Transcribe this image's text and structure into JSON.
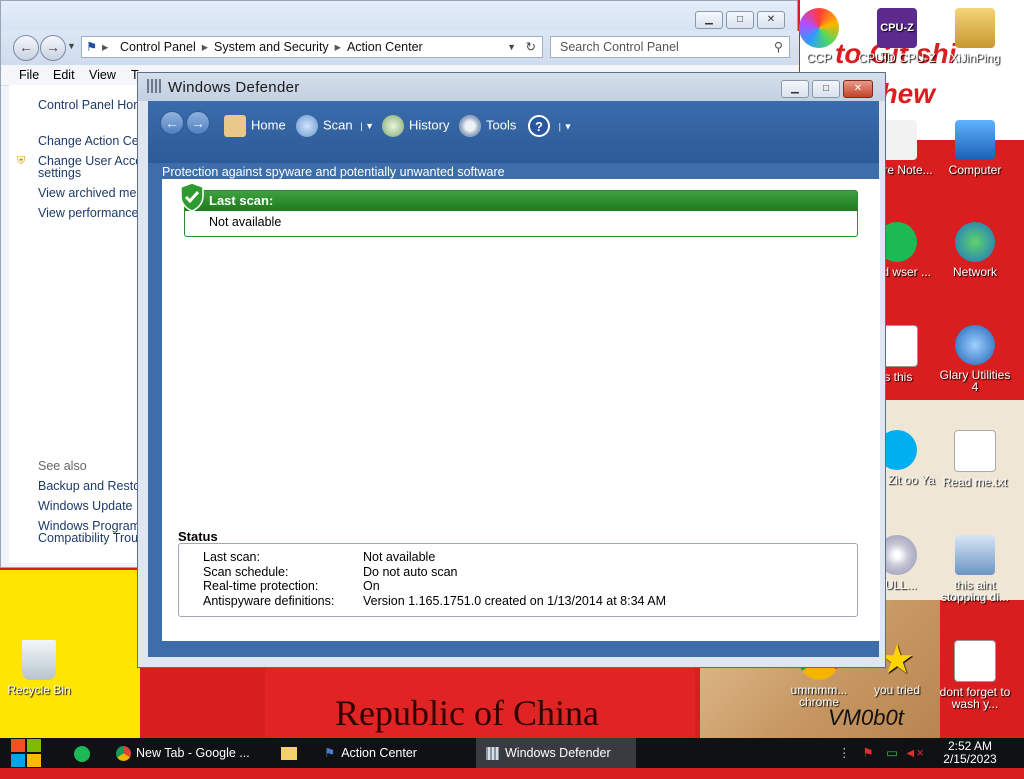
{
  "desktop": {
    "wallpaper_texts": [
      "to Git shi",
      "chew",
      "Republic of China",
      "VM0b0t"
    ],
    "icons": [
      {
        "label": "CCP",
        "icon": "colorful-logo-icon"
      },
      {
        "label": "CPUID CPU-Z",
        "icon": "cpuz-icon"
      },
      {
        "label": "XiJinPing",
        "icon": "user-file-icon"
      },
      {
        "label": "eware Note...",
        "icon": "notepad-icon"
      },
      {
        "label": "Computer",
        "icon": "computer-icon"
      },
      {
        "label": "ased wser ...",
        "icon": "spotify-icon"
      },
      {
        "label": "Network",
        "icon": "network-icon"
      },
      {
        "label": "is this",
        "icon": "document-icon"
      },
      {
        "label": "Glary Utilities 4",
        "icon": "glary-icon"
      },
      {
        "label": "what Zit oo Ya",
        "icon": "skype-icon"
      },
      {
        "label": "Read me.txt",
        "icon": "text-file-icon"
      },
      {
        "label": "BULL...",
        "icon": "disc-icon"
      },
      {
        "label": "this aint stopping di...",
        "icon": "setup-icon"
      },
      {
        "label": "ummmm... chrome",
        "icon": "chrome-icon"
      },
      {
        "label": "you tried",
        "icon": "star-icon"
      },
      {
        "label": "dont forget to wash y...",
        "icon": "document-icon"
      },
      {
        "label": "Recycle Bin",
        "icon": "recycle-bin-icon"
      }
    ]
  },
  "action_center": {
    "breadcrumb": [
      "Control Panel",
      "System and Security",
      "Action Center"
    ],
    "search_placeholder": "Search Control Panel",
    "menu": [
      "File",
      "Edit",
      "View",
      "T"
    ],
    "side_links": [
      "Control Panel Hom",
      "Change Action Cen",
      "Change User Acco",
      "settings",
      "View archived mes",
      "View performance"
    ],
    "see_also": "See also",
    "see_also_links": [
      "Backup and Resto",
      "Windows Update",
      "Windows Program",
      "Compatibility Troub"
    ]
  },
  "defender": {
    "title": "Windows Defender",
    "toolbar": {
      "home": "Home",
      "scan": "Scan",
      "history": "History",
      "tools": "Tools",
      "help": "?"
    },
    "subtitle": "Protection against spyware and potentially unwanted software",
    "last_scan_label": "Last scan:",
    "last_scan_value": "Not available",
    "status_title": "Status",
    "status": [
      {
        "label": "Last scan:",
        "value": "Not available"
      },
      {
        "label": "Scan schedule:",
        "value": "Do not auto scan"
      },
      {
        "label": "Real-time protection:",
        "value": "On"
      },
      {
        "label": "Antispyware definitions:",
        "value": "Version 1.165.1751.0 created on 1/13/2014 at 8:34 AM"
      }
    ]
  },
  "taskbar": {
    "items": [
      "New Tab - Google ...",
      "Action Center",
      "Windows Defender"
    ],
    "time": "2:52 AM",
    "date": "2/15/2023"
  },
  "colors": {
    "taskbar": "#101114",
    "defender_blue": "#3d6ea9",
    "scan_green": "#1d7b1d",
    "wallpaper_red": "#d81e1e"
  }
}
